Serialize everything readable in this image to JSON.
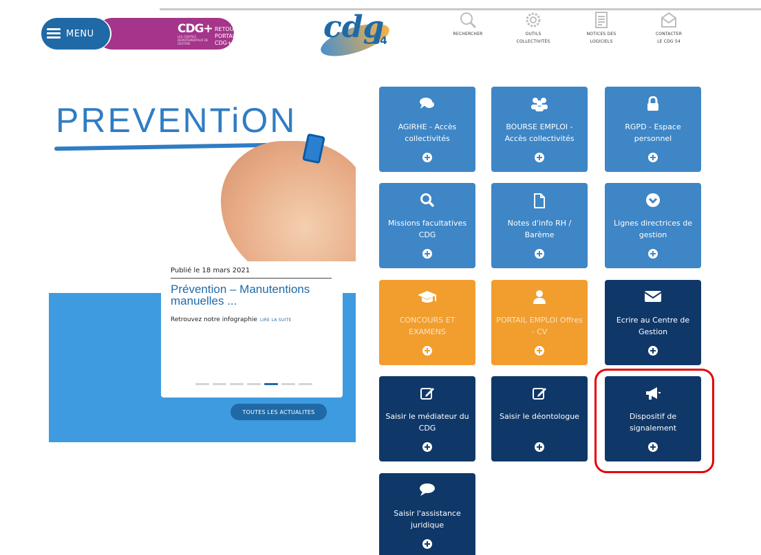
{
  "header": {
    "menu_label": "MENU",
    "cdg_logo": "CDG+",
    "cdg_logo_small": "LES CENTRES DEPARTEMENTAUX DE GESTION",
    "retour_line1": "RETOUR",
    "retour_line2": "PORTAIL CDG+",
    "brand_text": "cdg",
    "brand_number": "54"
  },
  "topnav": [
    {
      "icon": "search-icon",
      "line1": "RECHERCHER",
      "line2": ""
    },
    {
      "icon": "gear-icon",
      "line1": "OUTILS",
      "line2": "COLLECTIVITÉS"
    },
    {
      "icon": "document-icon",
      "line1": "NOTICES DES",
      "line2": "LOGICIELS"
    },
    {
      "icon": "envelope-icon",
      "line1": "CONTACTER",
      "line2": "LE CDG 54"
    }
  ],
  "hero": {
    "image_text": "PREVENTiON",
    "date": "Publié le 18 mars 2021",
    "title": "Prévention – Manutentions manuelles ...",
    "text": "Retrouvez notre infographie",
    "read_more": "LIRE LA SUITE",
    "all_news": "TOUTES LES ACTUALITES",
    "slides_total": 7,
    "slide_active": 5
  },
  "tiles": [
    {
      "label": "AGIRHE - Accès collectivités",
      "icon": "comments-icon",
      "color": "#3e86c6"
    },
    {
      "label": "BOURSE EMPLOI - Accès collectivités",
      "icon": "users-icon",
      "color": "#3e86c6"
    },
    {
      "label": "RGPD - Espace personnel",
      "icon": "lock-icon",
      "color": "#3e86c6"
    },
    {
      "label": "Missions facultatives CDG",
      "icon": "search-icon",
      "color": "#3e86c6"
    },
    {
      "label": "Notes d'info RH / Barème",
      "icon": "file-icon",
      "color": "#3e86c6"
    },
    {
      "label": "Lignes directrices de gestion",
      "icon": "chevron-circle-icon",
      "color": "#3e86c6"
    },
    {
      "label": "CONCOURS ET EXAMENS",
      "icon": "graduation-cap-icon",
      "color": "#f19e2e"
    },
    {
      "label": "PORTAIL EMPLOI Offres - CV",
      "icon": "user-icon",
      "color": "#f19e2e"
    },
    {
      "label": "Ecrire au Centre de Gestion",
      "icon": "envelope-icon",
      "color": "#0f3869"
    },
    {
      "label": "Saisir le médiateur du CDG",
      "icon": "edit-icon",
      "color": "#0f3869"
    },
    {
      "label": "Saisir le déontologue",
      "icon": "edit-icon",
      "color": "#0f3869"
    },
    {
      "label": "Dispositif de signalement",
      "icon": "bullhorn-icon",
      "color": "#0f3869"
    },
    {
      "label": "Saisir l'assistance juridique",
      "icon": "comment-icon",
      "color": "#0f3869"
    }
  ],
  "highlight": {
    "tile_index": 11,
    "color": "#e50000"
  }
}
